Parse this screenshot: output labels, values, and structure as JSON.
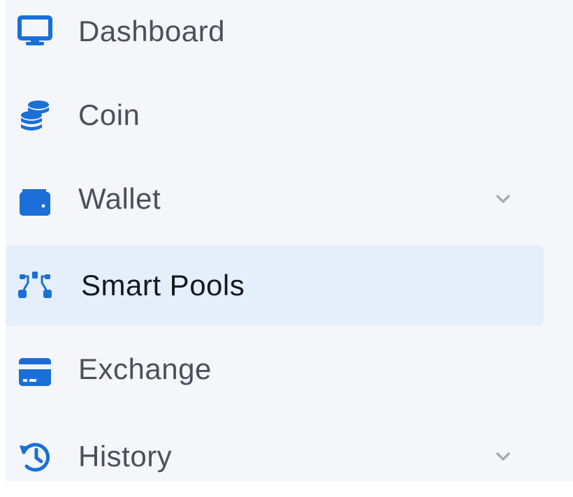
{
  "colors": {
    "icon_blue": "#1a6fd8",
    "active_bg": "#e5effb",
    "sidebar_bg": "#f4f6fa",
    "label": "#4c5058",
    "label_active": "#16191e",
    "chevron": "#a7abb3"
  },
  "sidebar": {
    "items": [
      {
        "label": "Dashboard",
        "icon": "desktop-icon",
        "active": false,
        "expandable": false
      },
      {
        "label": "Coin",
        "icon": "coins-icon",
        "active": false,
        "expandable": false
      },
      {
        "label": "Wallet",
        "icon": "wallet-icon",
        "active": false,
        "expandable": true
      },
      {
        "label": "Smart Pools",
        "icon": "network-nodes-icon",
        "active": true,
        "expandable": false
      },
      {
        "label": "Exchange",
        "icon": "credit-card-icon",
        "active": false,
        "expandable": false
      },
      {
        "label": "History",
        "icon": "history-icon",
        "active": false,
        "expandable": true
      }
    ]
  }
}
